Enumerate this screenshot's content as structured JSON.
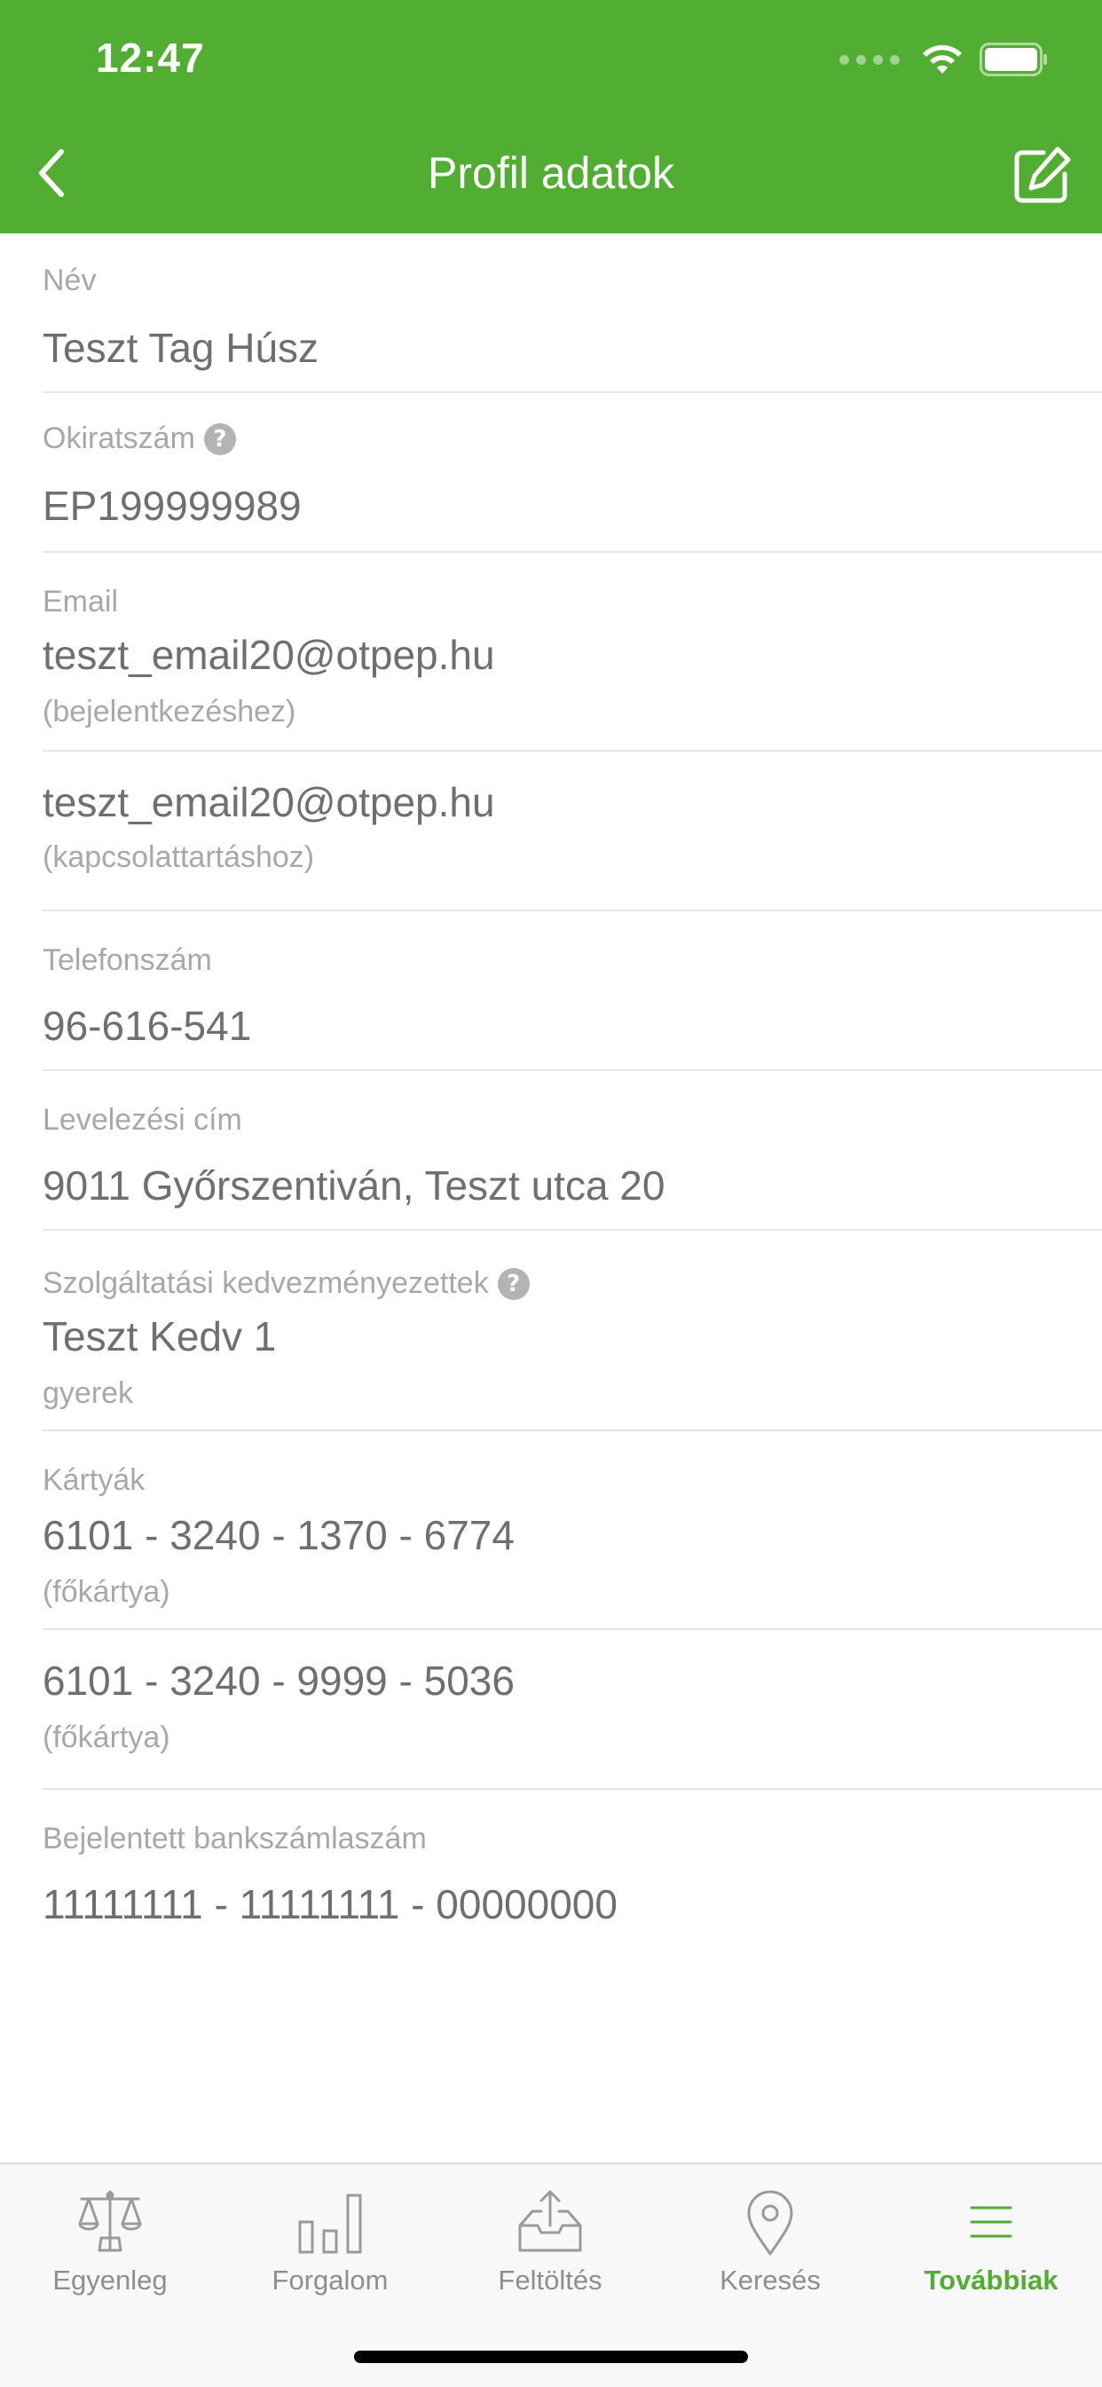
{
  "status_bar": {
    "time": "12:47"
  },
  "nav": {
    "title": "Profil adatok",
    "back_icon": "chevron-left-icon",
    "edit_icon": "edit-icon"
  },
  "fields": {
    "name": {
      "label": "Név",
      "value": "Teszt Tag Húsz"
    },
    "document": {
      "label": "Okiratszám",
      "value": "EP199999989"
    },
    "email": {
      "label": "Email",
      "value": "teszt_email20@otpep.hu",
      "note": "(bejelentkezéshez)"
    },
    "email_contact": {
      "value": "teszt_email20@otpep.hu",
      "note": "(kapcsolattartáshoz)"
    },
    "phone": {
      "label": "Telefonszám",
      "value": "96-616-541"
    },
    "address": {
      "label": "Levelezési cím",
      "value": "9011 Győrszentiván, Teszt utca 20"
    },
    "beneficiaries": {
      "label": "Szolgáltatási kedvezményezettek",
      "value": "Teszt Kedv 1",
      "note": "gyerek"
    },
    "cards": {
      "label": "Kártyák",
      "items": [
        {
          "value": "6101 - 3240 - 1370 - 6774",
          "note": "(főkártya)"
        },
        {
          "value": "6101 - 3240 - 9999 - 5036",
          "note": "(főkártya)"
        }
      ]
    },
    "bank_account": {
      "label": "Bejelentett bankszámlaszám",
      "value": "11111111 - 11111111 - 00000000"
    }
  },
  "tabbar": {
    "active_color": "#52ae32",
    "tabs": [
      {
        "label": "Egyenleg",
        "icon": "balance-scale-icon"
      },
      {
        "label": "Forgalom",
        "icon": "bar-chart-icon"
      },
      {
        "label": "Feltöltés",
        "icon": "upload-tray-icon"
      },
      {
        "label": "Keresés",
        "icon": "location-pin-icon"
      },
      {
        "label": "Továbbiak",
        "icon": "menu-icon",
        "active": true
      }
    ]
  },
  "colors": {
    "brand_green": "#52ae32",
    "value_text": "#6f6f6f",
    "label_text": "#a8a8a8"
  }
}
